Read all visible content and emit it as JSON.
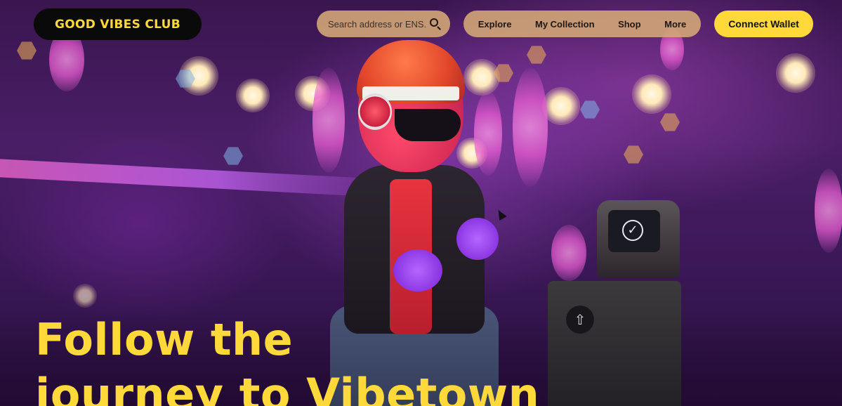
{
  "header": {
    "logo_text": "GOOD VIBES CLUB",
    "search": {
      "placeholder": "Search address or ENS...",
      "icon": "search-icon"
    },
    "menu": [
      {
        "label": "Explore"
      },
      {
        "label": "My Collection"
      },
      {
        "label": "Shop"
      },
      {
        "label": "More"
      }
    ],
    "connect_label": "Connect Wallet"
  },
  "hero": {
    "headline_line1": "Follow the",
    "headline_line2": "journey to Vibetown",
    "machine_icon_check": "✓",
    "machine_icon_arrow": "⇧"
  },
  "colors": {
    "accent": "#ffd93a",
    "pill": "#d6aa78",
    "logo_bg": "#0b0a0b"
  }
}
